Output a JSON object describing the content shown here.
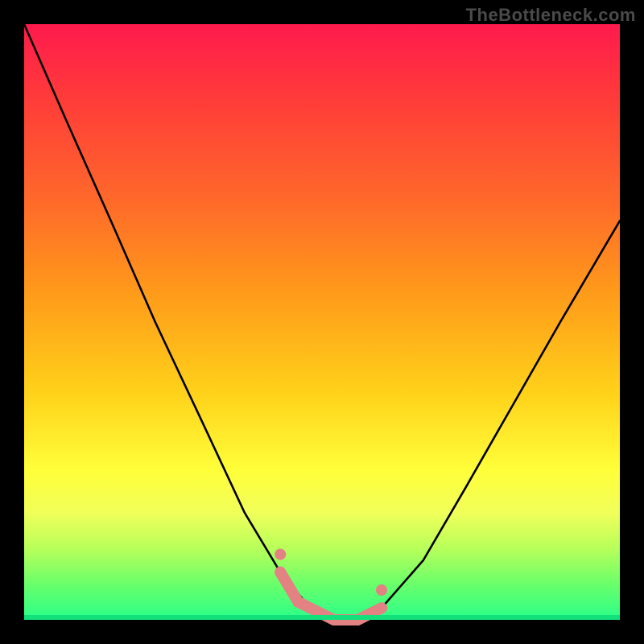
{
  "watermark": "TheBottleneck.com",
  "chart_data": {
    "type": "line",
    "title": "",
    "xlabel": "",
    "ylabel": "",
    "x_range": [
      0,
      100
    ],
    "y_range": [
      0,
      100
    ],
    "grid": false,
    "legend": false,
    "series": [
      {
        "name": "bottleneck-curve",
        "color": "#000000",
        "x": [
          0,
          7,
          15,
          22,
          30,
          37,
          43,
          48,
          52,
          56,
          60,
          67,
          74,
          82,
          90,
          100
        ],
        "values": [
          100,
          84,
          66,
          50,
          33,
          18,
          8,
          2,
          0,
          0,
          2,
          10,
          22,
          36,
          50,
          67
        ]
      },
      {
        "name": "highlight-segment",
        "color": "#e28282",
        "x": [
          43,
          46,
          48,
          52,
          56,
          60
        ],
        "values": [
          8,
          3,
          2,
          0,
          0,
          2
        ]
      }
    ],
    "annotations": [],
    "gradient_stops": [
      {
        "pos": 0,
        "color": "#ff1a4d"
      },
      {
        "pos": 12,
        "color": "#ff3a3a"
      },
      {
        "pos": 30,
        "color": "#ff6a2a"
      },
      {
        "pos": 45,
        "color": "#ff9a1a"
      },
      {
        "pos": 62,
        "color": "#ffd21a"
      },
      {
        "pos": 75,
        "color": "#ffff3a"
      },
      {
        "pos": 82,
        "color": "#f1ff5a"
      },
      {
        "pos": 88,
        "color": "#b8ff5a"
      },
      {
        "pos": 94,
        "color": "#6aff6a"
      },
      {
        "pos": 100,
        "color": "#2aff8a"
      }
    ]
  }
}
